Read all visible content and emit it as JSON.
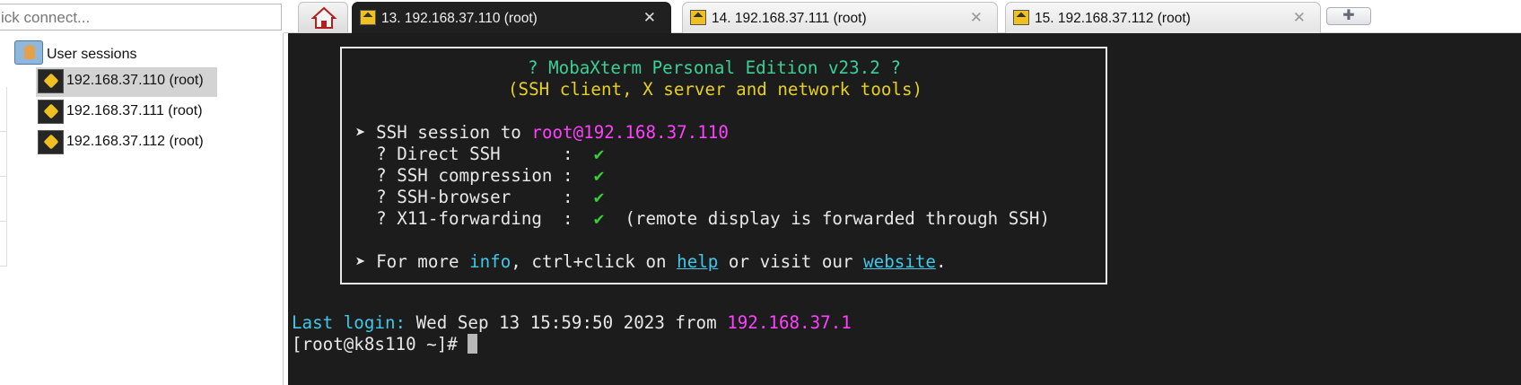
{
  "quick_connect": {
    "placeholder": "ick connect..."
  },
  "tabs": [
    {
      "label": "13. 192.168.37.110 (root)",
      "active": true
    },
    {
      "label": "14. 192.168.37.111 (root)",
      "active": false
    },
    {
      "label": "15. 192.168.37.112 (root)",
      "active": false
    }
  ],
  "sidebar": {
    "root_label": "User sessions",
    "sessions": [
      {
        "label": "192.168.37.110 (root)",
        "selected": true
      },
      {
        "label": "192.168.37.111 (root)",
        "selected": false
      },
      {
        "label": "192.168.37.112 (root)",
        "selected": false
      }
    ]
  },
  "terminal": {
    "banner": {
      "title": "? MobaXterm Personal Edition v23.2 ?",
      "subtitle": "(SSH client, X server and network tools)",
      "session_prefix": "➤ SSH session to ",
      "session_target": "root@192.168.37.110",
      "items": [
        {
          "label": "  ? Direct SSH      :  ",
          "check": "✔",
          "note": ""
        },
        {
          "label": "  ? SSH compression :  ",
          "check": "✔",
          "note": ""
        },
        {
          "label": "  ? SSH-browser     :  ",
          "check": "✔",
          "note": ""
        },
        {
          "label": "  ? X11-forwarding  :  ",
          "check": "✔",
          "note": "  (remote display is forwarded through SSH)"
        }
      ],
      "more_prefix": "➤ For more ",
      "more_info": "info",
      "more_mid": ", ctrl+click on ",
      "more_help": "help",
      "more_mid2": " or visit our ",
      "more_website": "website",
      "more_end": "."
    },
    "last_login_label": "Last login:",
    "last_login_date": " Wed Sep 13 15:59:50 2023 from ",
    "last_login_ip": "192.168.37.1",
    "prompt": "[root@k8s110 ~]# "
  },
  "colors": {
    "terminal_bg": "#1c1c1c",
    "green": "#3ad09a",
    "yellow": "#e6d020",
    "magenta": "#ff40ff",
    "cyan": "#40c8e8"
  }
}
